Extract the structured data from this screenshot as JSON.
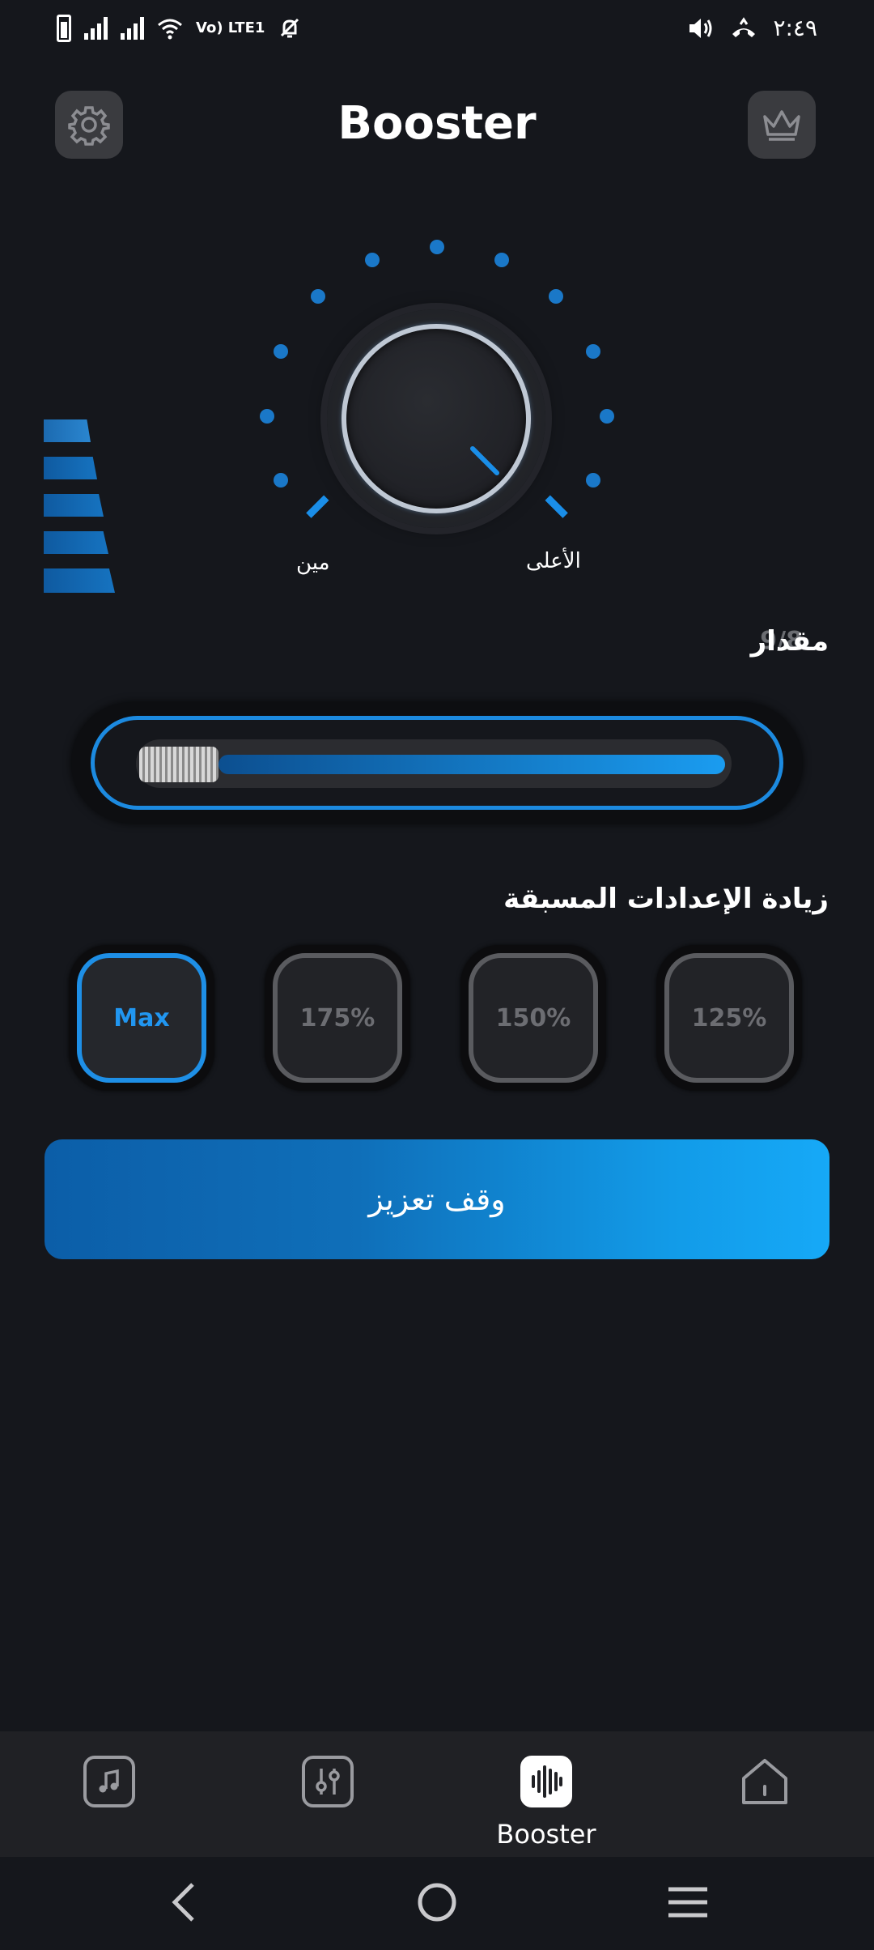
{
  "status_bar": {
    "volte_label": "Vo) LTE1",
    "time": "٢:٤٩"
  },
  "header": {
    "title": "Booster"
  },
  "knob": {
    "min_label": "مين",
    "max_label": "الأعلى"
  },
  "amount": {
    "label": "مقدار",
    "value": "9/8"
  },
  "presets": {
    "title": "زيادة الإعدادات المسبقة",
    "items": [
      "Max",
      "175%",
      "150%",
      "125%"
    ],
    "selected": "Max"
  },
  "stop_button": {
    "label": "وقف تعزيز"
  },
  "bottom_nav": {
    "items": [
      {
        "icon": "music-note-icon"
      },
      {
        "icon": "equalizer-icon"
      },
      {
        "icon": "waveform-icon",
        "label": "Booster",
        "active": true
      },
      {
        "icon": "home-icon"
      }
    ]
  },
  "system_nav": {
    "items": [
      "back-icon",
      "home-circle-icon",
      "menu-icon"
    ]
  },
  "colors": {
    "background": "#15171c",
    "accent": "#1e8fe6",
    "button_gradient_start": "#0c5ea8",
    "button_gradient_end": "#16a9f7"
  }
}
